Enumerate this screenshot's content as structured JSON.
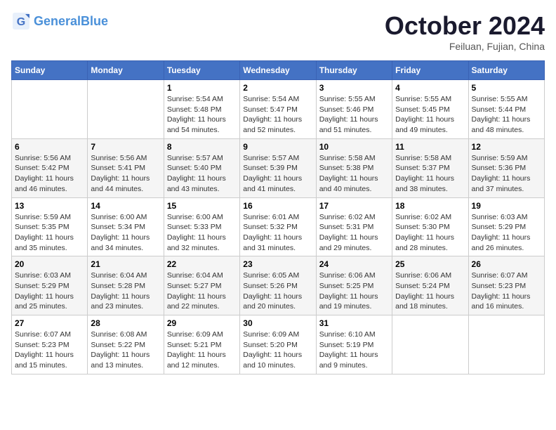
{
  "header": {
    "logo_general": "General",
    "logo_blue": "Blue",
    "month_title": "October 2024",
    "location": "Feiluan, Fujian, China"
  },
  "weekdays": [
    "Sunday",
    "Monday",
    "Tuesday",
    "Wednesday",
    "Thursday",
    "Friday",
    "Saturday"
  ],
  "weeks": [
    [
      {
        "day": "",
        "info": ""
      },
      {
        "day": "",
        "info": ""
      },
      {
        "day": "1",
        "info": "Sunrise: 5:54 AM\nSunset: 5:48 PM\nDaylight: 11 hours and 54 minutes."
      },
      {
        "day": "2",
        "info": "Sunrise: 5:54 AM\nSunset: 5:47 PM\nDaylight: 11 hours and 52 minutes."
      },
      {
        "day": "3",
        "info": "Sunrise: 5:55 AM\nSunset: 5:46 PM\nDaylight: 11 hours and 51 minutes."
      },
      {
        "day": "4",
        "info": "Sunrise: 5:55 AM\nSunset: 5:45 PM\nDaylight: 11 hours and 49 minutes."
      },
      {
        "day": "5",
        "info": "Sunrise: 5:55 AM\nSunset: 5:44 PM\nDaylight: 11 hours and 48 minutes."
      }
    ],
    [
      {
        "day": "6",
        "info": "Sunrise: 5:56 AM\nSunset: 5:42 PM\nDaylight: 11 hours and 46 minutes."
      },
      {
        "day": "7",
        "info": "Sunrise: 5:56 AM\nSunset: 5:41 PM\nDaylight: 11 hours and 44 minutes."
      },
      {
        "day": "8",
        "info": "Sunrise: 5:57 AM\nSunset: 5:40 PM\nDaylight: 11 hours and 43 minutes."
      },
      {
        "day": "9",
        "info": "Sunrise: 5:57 AM\nSunset: 5:39 PM\nDaylight: 11 hours and 41 minutes."
      },
      {
        "day": "10",
        "info": "Sunrise: 5:58 AM\nSunset: 5:38 PM\nDaylight: 11 hours and 40 minutes."
      },
      {
        "day": "11",
        "info": "Sunrise: 5:58 AM\nSunset: 5:37 PM\nDaylight: 11 hours and 38 minutes."
      },
      {
        "day": "12",
        "info": "Sunrise: 5:59 AM\nSunset: 5:36 PM\nDaylight: 11 hours and 37 minutes."
      }
    ],
    [
      {
        "day": "13",
        "info": "Sunrise: 5:59 AM\nSunset: 5:35 PM\nDaylight: 11 hours and 35 minutes."
      },
      {
        "day": "14",
        "info": "Sunrise: 6:00 AM\nSunset: 5:34 PM\nDaylight: 11 hours and 34 minutes."
      },
      {
        "day": "15",
        "info": "Sunrise: 6:00 AM\nSunset: 5:33 PM\nDaylight: 11 hours and 32 minutes."
      },
      {
        "day": "16",
        "info": "Sunrise: 6:01 AM\nSunset: 5:32 PM\nDaylight: 11 hours and 31 minutes."
      },
      {
        "day": "17",
        "info": "Sunrise: 6:02 AM\nSunset: 5:31 PM\nDaylight: 11 hours and 29 minutes."
      },
      {
        "day": "18",
        "info": "Sunrise: 6:02 AM\nSunset: 5:30 PM\nDaylight: 11 hours and 28 minutes."
      },
      {
        "day": "19",
        "info": "Sunrise: 6:03 AM\nSunset: 5:29 PM\nDaylight: 11 hours and 26 minutes."
      }
    ],
    [
      {
        "day": "20",
        "info": "Sunrise: 6:03 AM\nSunset: 5:29 PM\nDaylight: 11 hours and 25 minutes."
      },
      {
        "day": "21",
        "info": "Sunrise: 6:04 AM\nSunset: 5:28 PM\nDaylight: 11 hours and 23 minutes."
      },
      {
        "day": "22",
        "info": "Sunrise: 6:04 AM\nSunset: 5:27 PM\nDaylight: 11 hours and 22 minutes."
      },
      {
        "day": "23",
        "info": "Sunrise: 6:05 AM\nSunset: 5:26 PM\nDaylight: 11 hours and 20 minutes."
      },
      {
        "day": "24",
        "info": "Sunrise: 6:06 AM\nSunset: 5:25 PM\nDaylight: 11 hours and 19 minutes."
      },
      {
        "day": "25",
        "info": "Sunrise: 6:06 AM\nSunset: 5:24 PM\nDaylight: 11 hours and 18 minutes."
      },
      {
        "day": "26",
        "info": "Sunrise: 6:07 AM\nSunset: 5:23 PM\nDaylight: 11 hours and 16 minutes."
      }
    ],
    [
      {
        "day": "27",
        "info": "Sunrise: 6:07 AM\nSunset: 5:23 PM\nDaylight: 11 hours and 15 minutes."
      },
      {
        "day": "28",
        "info": "Sunrise: 6:08 AM\nSunset: 5:22 PM\nDaylight: 11 hours and 13 minutes."
      },
      {
        "day": "29",
        "info": "Sunrise: 6:09 AM\nSunset: 5:21 PM\nDaylight: 11 hours and 12 minutes."
      },
      {
        "day": "30",
        "info": "Sunrise: 6:09 AM\nSunset: 5:20 PM\nDaylight: 11 hours and 10 minutes."
      },
      {
        "day": "31",
        "info": "Sunrise: 6:10 AM\nSunset: 5:19 PM\nDaylight: 11 hours and 9 minutes."
      },
      {
        "day": "",
        "info": ""
      },
      {
        "day": "",
        "info": ""
      }
    ]
  ]
}
